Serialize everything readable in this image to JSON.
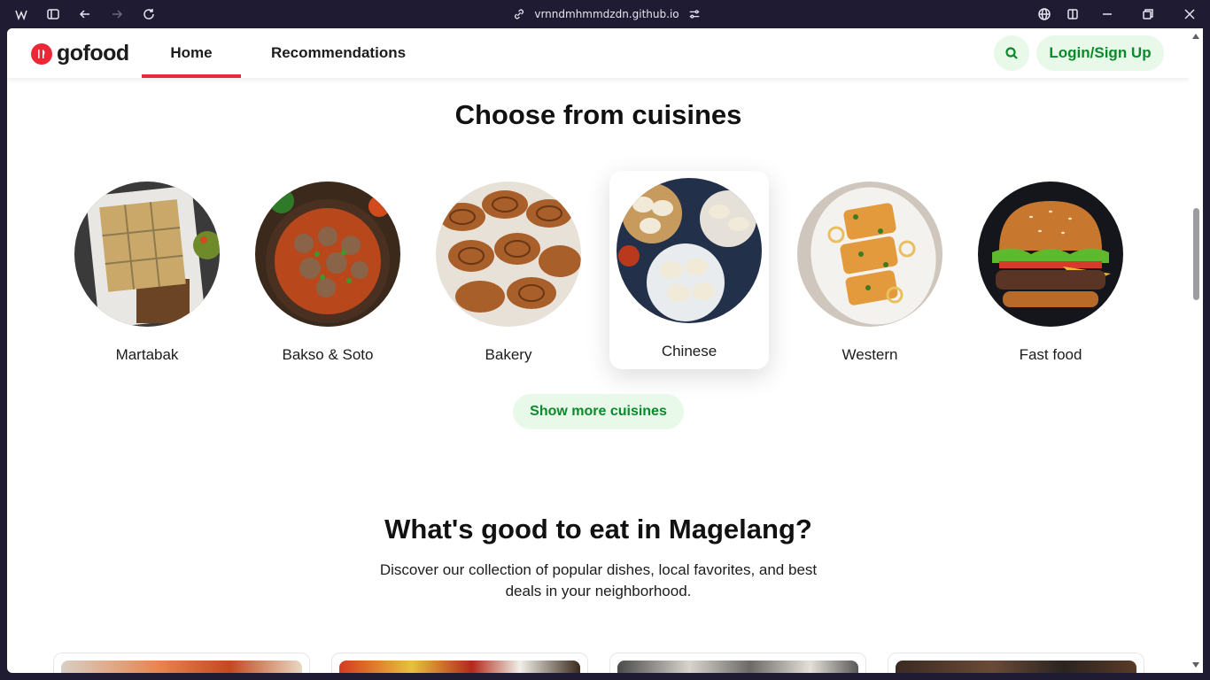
{
  "browser": {
    "url": "vrnndmhmmdzdn.github.io"
  },
  "site": {
    "logo_text": "gofood",
    "nav": [
      {
        "label": "Home",
        "active": true
      },
      {
        "label": "Recommendations",
        "active": false
      }
    ],
    "login_label": "Login/Sign Up",
    "brand_color": "#ee2737",
    "accent_green": "#0a8a2a"
  },
  "cuisines": {
    "title": "Choose from cuisines",
    "items": [
      {
        "label": "Martabak",
        "image": "martabak-photo"
      },
      {
        "label": "Bakso & Soto",
        "image": "bakso-photo"
      },
      {
        "label": "Bakery",
        "image": "bakery-photo"
      },
      {
        "label": "Chinese",
        "image": "dumplings-photo",
        "hovered": true
      },
      {
        "label": "Western",
        "image": "western-photo"
      },
      {
        "label": "Fast food",
        "image": "burger-photo"
      }
    ],
    "show_more_label": "Show more cuisines"
  },
  "discover": {
    "title": "What's good to eat in Magelang?",
    "description": "Discover our collection of popular dishes, local favorites, and best deals in your neighborhood."
  }
}
